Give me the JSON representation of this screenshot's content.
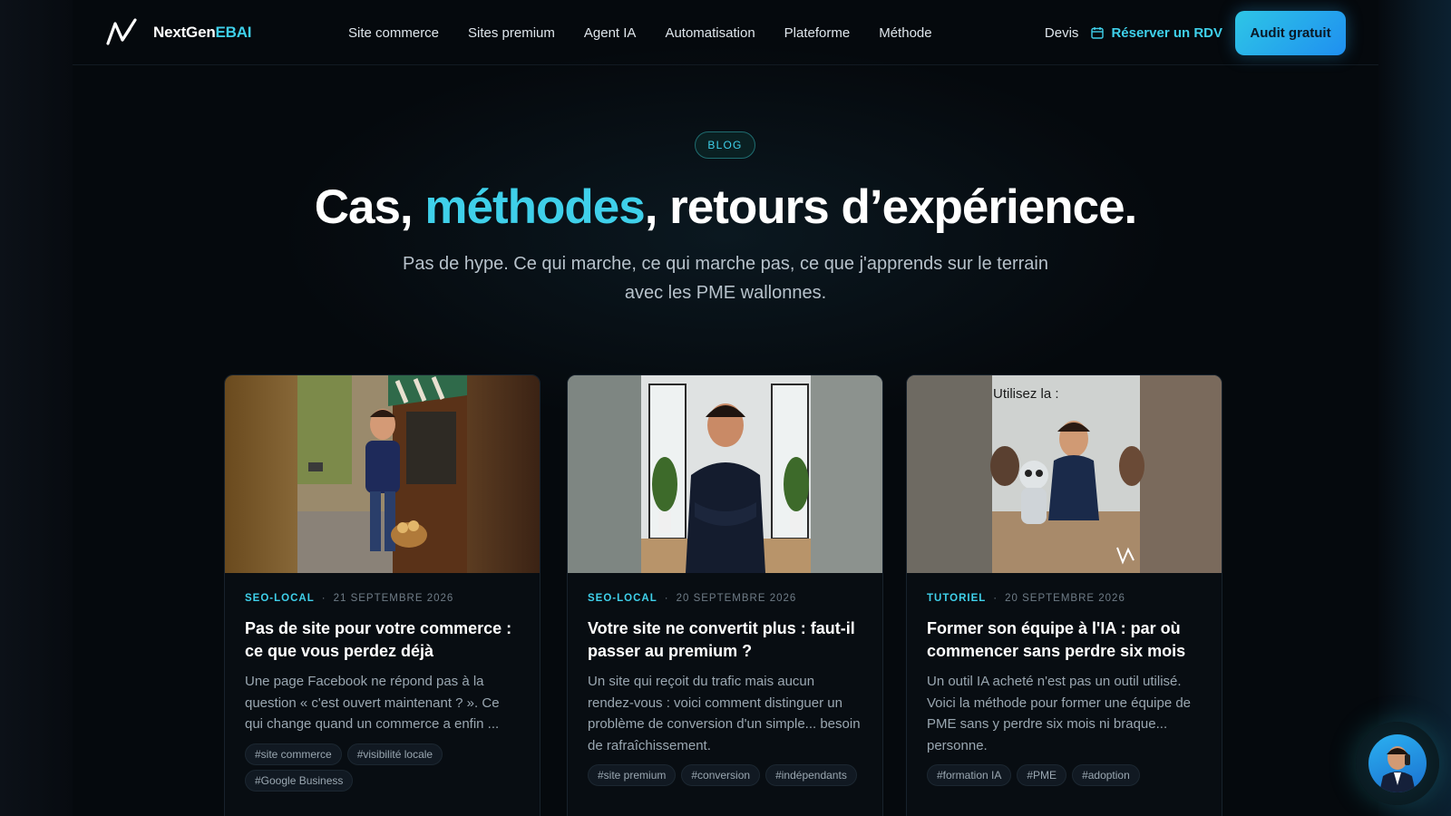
{
  "brand": {
    "name_part1": "NextGen",
    "name_part2": "EBAI"
  },
  "nav": {
    "items": [
      "Site commerce",
      "Sites premium",
      "Agent IA",
      "Automatisation",
      "Plateforme",
      "Méthode"
    ]
  },
  "actions": {
    "devis": "Devis",
    "rdv": "Réserver un RDV",
    "audit": "Audit gratuit"
  },
  "hero": {
    "badge": "BLOG",
    "title_before": "Cas, ",
    "title_highlight": "méthodes",
    "title_after": ", retours d’expérience.",
    "subtitle": "Pas de hype. Ce qui marche, ce qui marche pas, ce que j'apprends sur le terrain avec les PME wallonnes."
  },
  "cards": [
    {
      "category": "SEO-LOCAL",
      "date": "21 SEPTEMBRE 2026",
      "title": "Pas de site pour votre commerce : ce que vous perdez déjà",
      "excerpt": "Une page Facebook ne répond pas à la question « c'est ouvert maintenant ? ». Ce qui change quand un commerce a enfin ...",
      "tags": [
        "#site commerce",
        "#visibilité locale",
        "#Google Business"
      ]
    },
    {
      "category": "SEO-LOCAL",
      "date": "20 SEPTEMBRE 2026",
      "title": "Votre site ne convertit plus : faut-il passer au premium ?",
      "excerpt": "Un site qui reçoit du trafic mais aucun rendez-vous : voici comment distinguer un problème de conversion d'un simple... besoin de rafraîchissement.",
      "tags": [
        "#site premium",
        "#conversion",
        "#indépendants"
      ]
    },
    {
      "category": "TUTORIEL",
      "date": "20 SEPTEMBRE 2026",
      "title": "Former son équipe à l'IA : par où commencer sans perdre six mois",
      "excerpt": "Un outil IA acheté n'est pas un outil utilisé. Voici la méthode pour former une équipe de PME sans y perdre six mois ni braque... personne.",
      "tags": [
        "#formation IA",
        "#PME",
        "#adoption"
      ],
      "image_caption": "Utilisez la :"
    }
  ],
  "colors": {
    "accent": "#3fd0ea",
    "background": "#05090d",
    "button": "#2ec6e6"
  }
}
